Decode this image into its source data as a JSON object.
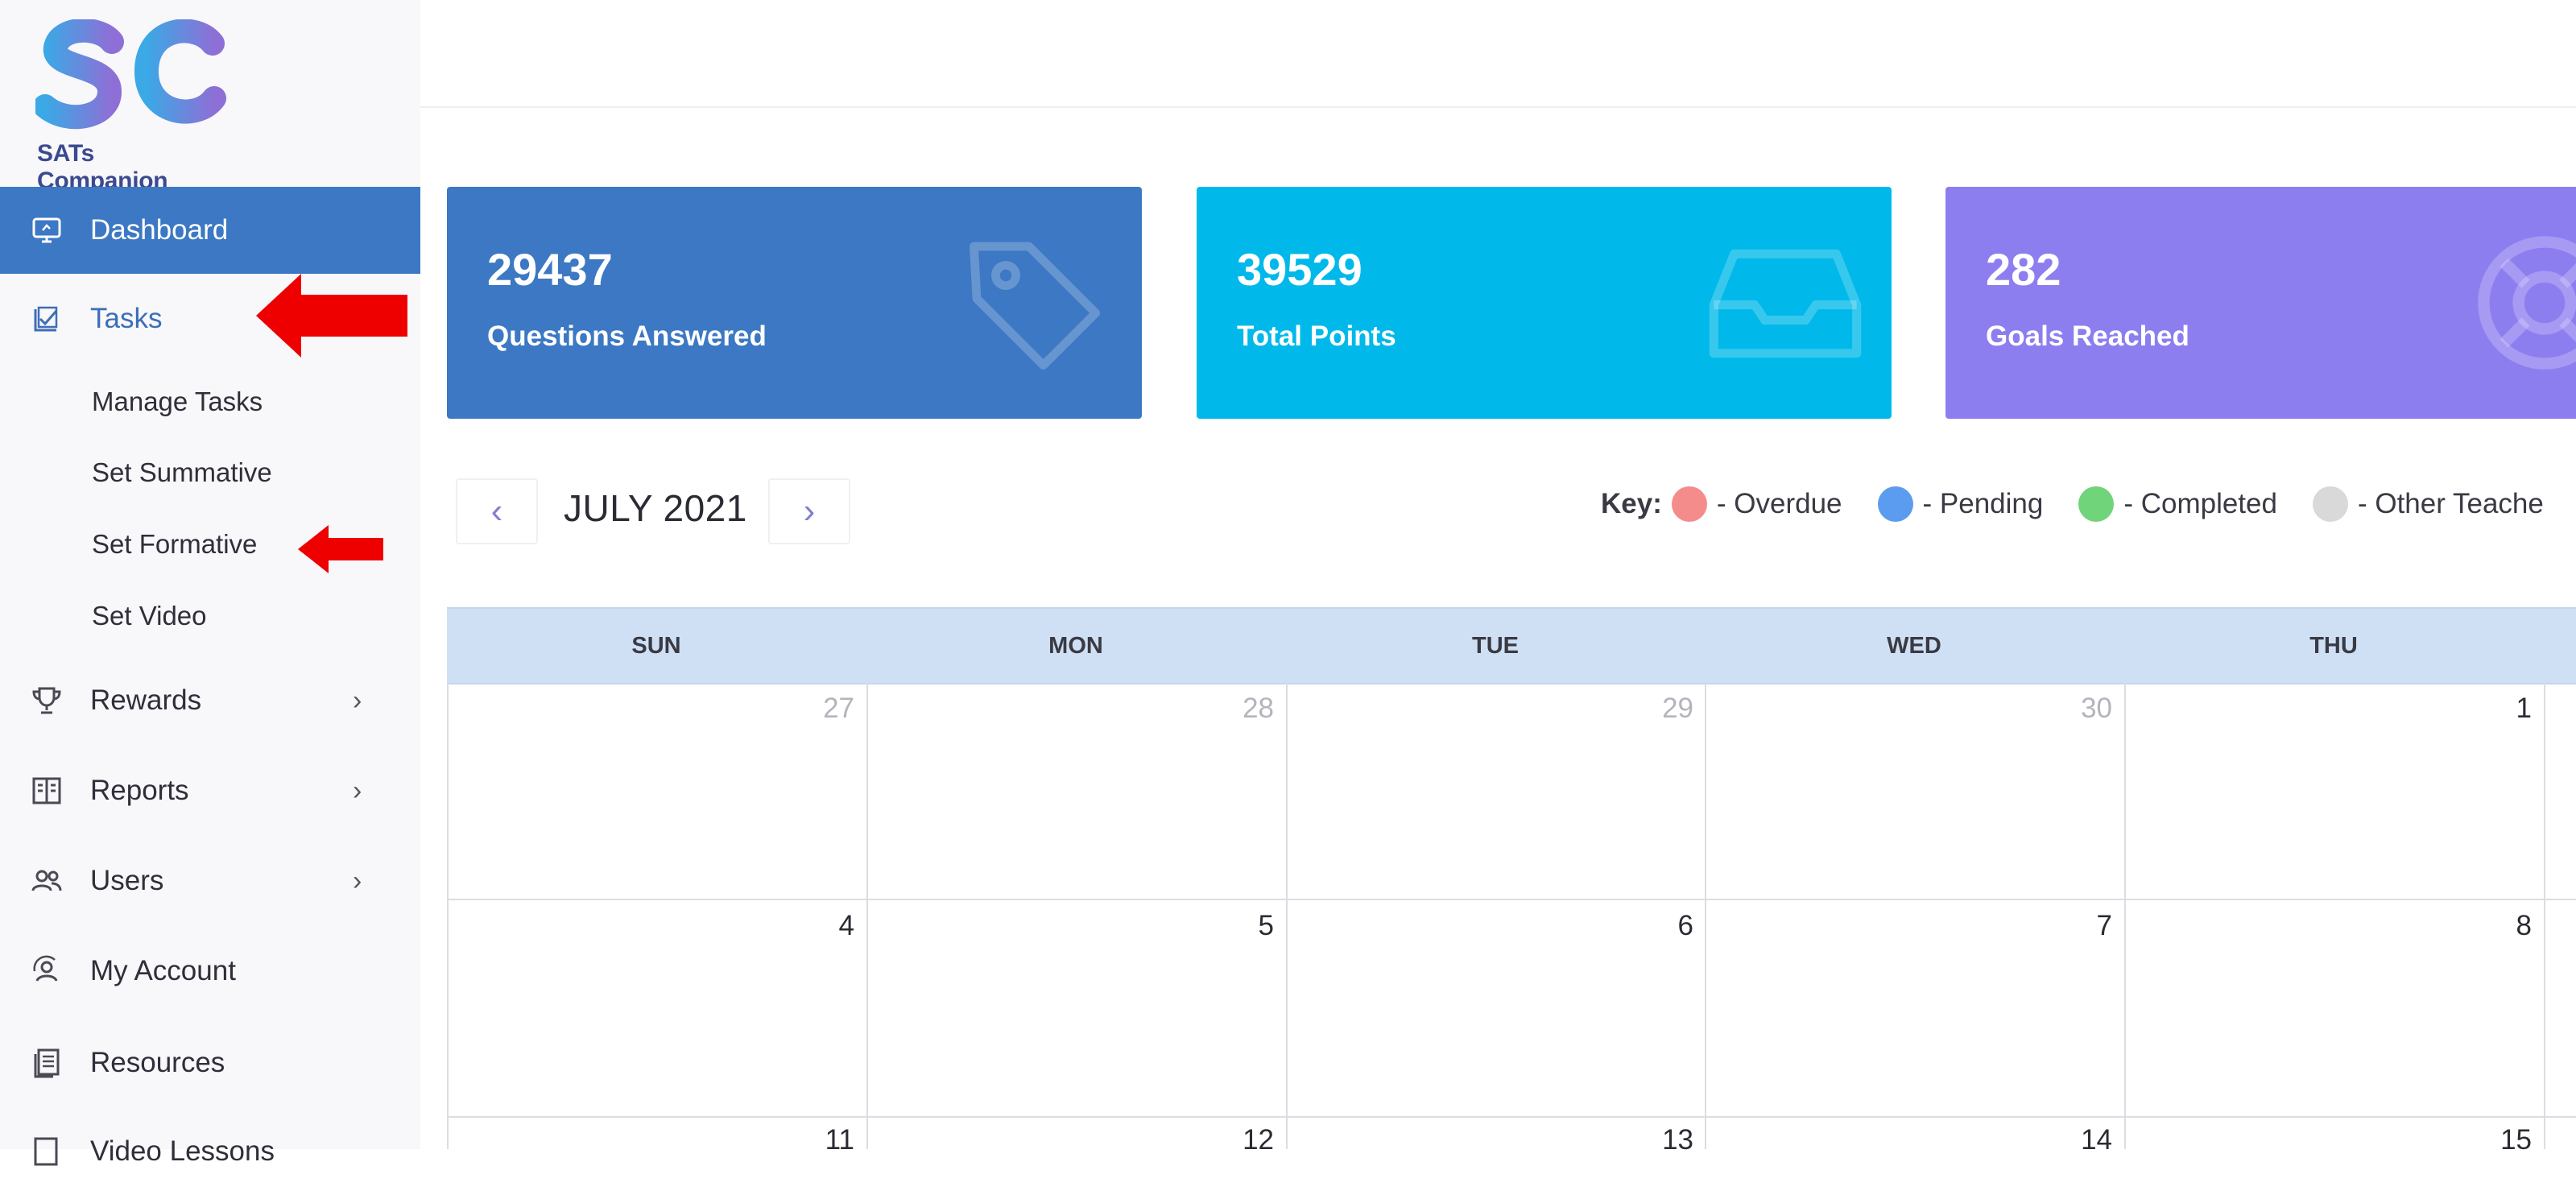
{
  "app": {
    "logo_text": "SATs Companion"
  },
  "sidebar": {
    "items": [
      {
        "label": "Dashboard",
        "icon": "monitor-icon"
      },
      {
        "label": "Tasks",
        "icon": "task-check-icon"
      },
      {
        "label": "Rewards",
        "icon": "trophy-icon"
      },
      {
        "label": "Reports",
        "icon": "report-icon"
      },
      {
        "label": "Users",
        "icon": "users-icon"
      },
      {
        "label": "My Account",
        "icon": "account-icon"
      },
      {
        "label": "Resources",
        "icon": "resources-icon"
      },
      {
        "label": "Video Lessons",
        "icon": "video-icon"
      }
    ],
    "tasks_sub": [
      "Manage Tasks",
      "Set Summative",
      "Set Formative",
      "Set Video"
    ]
  },
  "stats": [
    {
      "value": "29437",
      "label": "Questions Answered",
      "color": "#3c78c3",
      "icon": "tag-icon"
    },
    {
      "value": "39529",
      "label": "Total Points",
      "color": "#00b9ea",
      "icon": "inbox-icon"
    },
    {
      "value": "282",
      "label": "Goals Reached",
      "color": "#8d7ef0",
      "icon": "lifebuoy-icon"
    }
  ],
  "calendar": {
    "month": "JULY 2021",
    "key_label": "Key:",
    "key": [
      {
        "label": "- Overdue",
        "color": "#f48c8c"
      },
      {
        "label": "- Pending",
        "color": "#5b9cf0"
      },
      {
        "label": "- Completed",
        "color": "#6fd47a"
      },
      {
        "label": "- Other Teache",
        "color": "#d9d9d9"
      }
    ],
    "days": [
      "SUN",
      "MON",
      "TUE",
      "WED",
      "THU"
    ],
    "weeks": [
      [
        "27",
        "28",
        "29",
        "30",
        "1"
      ],
      [
        "4",
        "5",
        "6",
        "7",
        "8"
      ],
      [
        "11",
        "12",
        "13",
        "14",
        "15"
      ]
    ]
  }
}
